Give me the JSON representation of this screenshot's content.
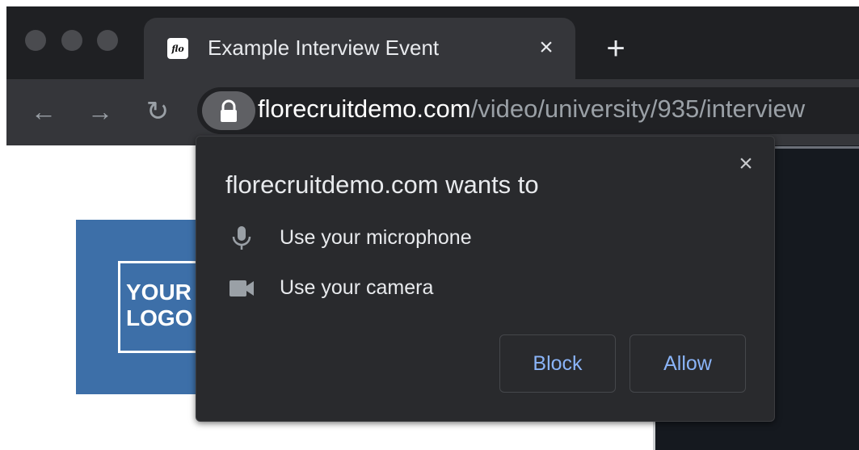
{
  "browser": {
    "tab": {
      "favicon_text": "flo",
      "title": "Example Interview Event",
      "close_glyph": "×"
    },
    "new_tab_glyph": "+",
    "nav": {
      "back_glyph": "←",
      "forward_glyph": "→",
      "reload_glyph": "↻"
    },
    "address": {
      "domain": "florecruitdemo.com",
      "path": "/video/university/935/interview"
    }
  },
  "page": {
    "logo_lines": [
      "YOUR",
      "LOGO"
    ]
  },
  "permission_popup": {
    "title": "florecruitdemo.com wants to",
    "close_glyph": "×",
    "permissions": [
      {
        "icon": "microphone-icon",
        "label": "Use your microphone"
      },
      {
        "icon": "camera-icon",
        "label": "Use your camera"
      }
    ],
    "block_label": "Block",
    "allow_label": "Allow"
  },
  "colors": {
    "tab_bar": "#1f2023",
    "toolbar": "#35363a",
    "popup_bg": "#292a2d",
    "link_blue": "#8ab4f8",
    "logo_blue": "#3d6fa8"
  }
}
